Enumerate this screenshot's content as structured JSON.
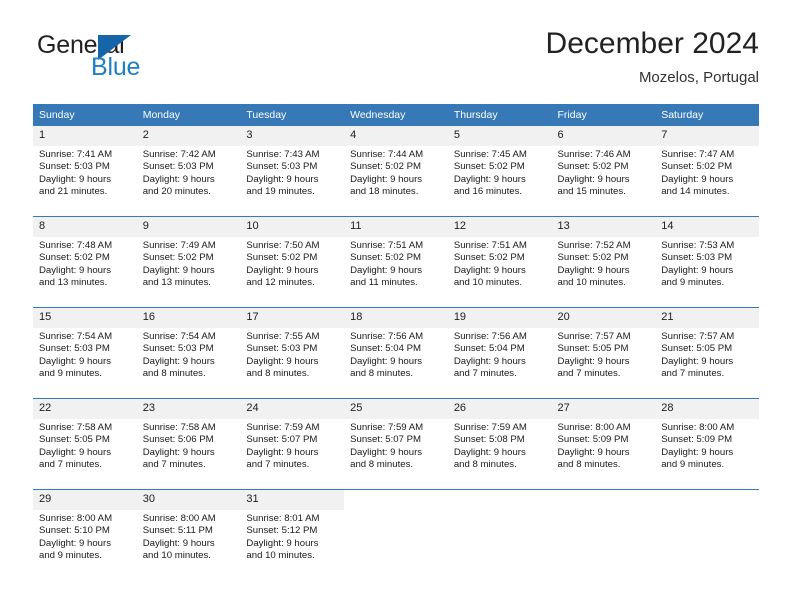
{
  "brand": {
    "name_top": "General",
    "name_bottom": "Blue",
    "triangle_icon": "triangle-logo-icon",
    "color_primary": "#1565a8",
    "color_secondary": "#1f7fc4"
  },
  "header": {
    "title": "December 2024",
    "location": "Mozelos, Portugal"
  },
  "theme": {
    "header_bg": "#3679b6",
    "daynum_bg": "#f1f1f1",
    "grid_line": "#3679b6"
  },
  "weekday_headers": [
    "Sunday",
    "Monday",
    "Tuesday",
    "Wednesday",
    "Thursday",
    "Friday",
    "Saturday"
  ],
  "weeks": [
    [
      {
        "day": "1",
        "sunrise": "Sunrise: 7:41 AM",
        "sunset": "Sunset: 5:03 PM",
        "daylight1": "Daylight: 9 hours",
        "daylight2": "and 21 minutes."
      },
      {
        "day": "2",
        "sunrise": "Sunrise: 7:42 AM",
        "sunset": "Sunset: 5:03 PM",
        "daylight1": "Daylight: 9 hours",
        "daylight2": "and 20 minutes."
      },
      {
        "day": "3",
        "sunrise": "Sunrise: 7:43 AM",
        "sunset": "Sunset: 5:03 PM",
        "daylight1": "Daylight: 9 hours",
        "daylight2": "and 19 minutes."
      },
      {
        "day": "4",
        "sunrise": "Sunrise: 7:44 AM",
        "sunset": "Sunset: 5:02 PM",
        "daylight1": "Daylight: 9 hours",
        "daylight2": "and 18 minutes."
      },
      {
        "day": "5",
        "sunrise": "Sunrise: 7:45 AM",
        "sunset": "Sunset: 5:02 PM",
        "daylight1": "Daylight: 9 hours",
        "daylight2": "and 16 minutes."
      },
      {
        "day": "6",
        "sunrise": "Sunrise: 7:46 AM",
        "sunset": "Sunset: 5:02 PM",
        "daylight1": "Daylight: 9 hours",
        "daylight2": "and 15 minutes."
      },
      {
        "day": "7",
        "sunrise": "Sunrise: 7:47 AM",
        "sunset": "Sunset: 5:02 PM",
        "daylight1": "Daylight: 9 hours",
        "daylight2": "and 14 minutes."
      }
    ],
    [
      {
        "day": "8",
        "sunrise": "Sunrise: 7:48 AM",
        "sunset": "Sunset: 5:02 PM",
        "daylight1": "Daylight: 9 hours",
        "daylight2": "and 13 minutes."
      },
      {
        "day": "9",
        "sunrise": "Sunrise: 7:49 AM",
        "sunset": "Sunset: 5:02 PM",
        "daylight1": "Daylight: 9 hours",
        "daylight2": "and 13 minutes."
      },
      {
        "day": "10",
        "sunrise": "Sunrise: 7:50 AM",
        "sunset": "Sunset: 5:02 PM",
        "daylight1": "Daylight: 9 hours",
        "daylight2": "and 12 minutes."
      },
      {
        "day": "11",
        "sunrise": "Sunrise: 7:51 AM",
        "sunset": "Sunset: 5:02 PM",
        "daylight1": "Daylight: 9 hours",
        "daylight2": "and 11 minutes."
      },
      {
        "day": "12",
        "sunrise": "Sunrise: 7:51 AM",
        "sunset": "Sunset: 5:02 PM",
        "daylight1": "Daylight: 9 hours",
        "daylight2": "and 10 minutes."
      },
      {
        "day": "13",
        "sunrise": "Sunrise: 7:52 AM",
        "sunset": "Sunset: 5:02 PM",
        "daylight1": "Daylight: 9 hours",
        "daylight2": "and 10 minutes."
      },
      {
        "day": "14",
        "sunrise": "Sunrise: 7:53 AM",
        "sunset": "Sunset: 5:03 PM",
        "daylight1": "Daylight: 9 hours",
        "daylight2": "and 9 minutes."
      }
    ],
    [
      {
        "day": "15",
        "sunrise": "Sunrise: 7:54 AM",
        "sunset": "Sunset: 5:03 PM",
        "daylight1": "Daylight: 9 hours",
        "daylight2": "and 9 minutes."
      },
      {
        "day": "16",
        "sunrise": "Sunrise: 7:54 AM",
        "sunset": "Sunset: 5:03 PM",
        "daylight1": "Daylight: 9 hours",
        "daylight2": "and 8 minutes."
      },
      {
        "day": "17",
        "sunrise": "Sunrise: 7:55 AM",
        "sunset": "Sunset: 5:03 PM",
        "daylight1": "Daylight: 9 hours",
        "daylight2": "and 8 minutes."
      },
      {
        "day": "18",
        "sunrise": "Sunrise: 7:56 AM",
        "sunset": "Sunset: 5:04 PM",
        "daylight1": "Daylight: 9 hours",
        "daylight2": "and 8 minutes."
      },
      {
        "day": "19",
        "sunrise": "Sunrise: 7:56 AM",
        "sunset": "Sunset: 5:04 PM",
        "daylight1": "Daylight: 9 hours",
        "daylight2": "and 7 minutes."
      },
      {
        "day": "20",
        "sunrise": "Sunrise: 7:57 AM",
        "sunset": "Sunset: 5:05 PM",
        "daylight1": "Daylight: 9 hours",
        "daylight2": "and 7 minutes."
      },
      {
        "day": "21",
        "sunrise": "Sunrise: 7:57 AM",
        "sunset": "Sunset: 5:05 PM",
        "daylight1": "Daylight: 9 hours",
        "daylight2": "and 7 minutes."
      }
    ],
    [
      {
        "day": "22",
        "sunrise": "Sunrise: 7:58 AM",
        "sunset": "Sunset: 5:05 PM",
        "daylight1": "Daylight: 9 hours",
        "daylight2": "and 7 minutes."
      },
      {
        "day": "23",
        "sunrise": "Sunrise: 7:58 AM",
        "sunset": "Sunset: 5:06 PM",
        "daylight1": "Daylight: 9 hours",
        "daylight2": "and 7 minutes."
      },
      {
        "day": "24",
        "sunrise": "Sunrise: 7:59 AM",
        "sunset": "Sunset: 5:07 PM",
        "daylight1": "Daylight: 9 hours",
        "daylight2": "and 7 minutes."
      },
      {
        "day": "25",
        "sunrise": "Sunrise: 7:59 AM",
        "sunset": "Sunset: 5:07 PM",
        "daylight1": "Daylight: 9 hours",
        "daylight2": "and 8 minutes."
      },
      {
        "day": "26",
        "sunrise": "Sunrise: 7:59 AM",
        "sunset": "Sunset: 5:08 PM",
        "daylight1": "Daylight: 9 hours",
        "daylight2": "and 8 minutes."
      },
      {
        "day": "27",
        "sunrise": "Sunrise: 8:00 AM",
        "sunset": "Sunset: 5:09 PM",
        "daylight1": "Daylight: 9 hours",
        "daylight2": "and 8 minutes."
      },
      {
        "day": "28",
        "sunrise": "Sunrise: 8:00 AM",
        "sunset": "Sunset: 5:09 PM",
        "daylight1": "Daylight: 9 hours",
        "daylight2": "and 9 minutes."
      }
    ],
    [
      {
        "day": "29",
        "sunrise": "Sunrise: 8:00 AM",
        "sunset": "Sunset: 5:10 PM",
        "daylight1": "Daylight: 9 hours",
        "daylight2": "and 9 minutes."
      },
      {
        "day": "30",
        "sunrise": "Sunrise: 8:00 AM",
        "sunset": "Sunset: 5:11 PM",
        "daylight1": "Daylight: 9 hours",
        "daylight2": "and 10 minutes."
      },
      {
        "day": "31",
        "sunrise": "Sunrise: 8:01 AM",
        "sunset": "Sunset: 5:12 PM",
        "daylight1": "Daylight: 9 hours",
        "daylight2": "and 10 minutes."
      },
      {
        "day": "",
        "sunrise": "",
        "sunset": "",
        "daylight1": "",
        "daylight2": ""
      },
      {
        "day": "",
        "sunrise": "",
        "sunset": "",
        "daylight1": "",
        "daylight2": ""
      },
      {
        "day": "",
        "sunrise": "",
        "sunset": "",
        "daylight1": "",
        "daylight2": ""
      },
      {
        "day": "",
        "sunrise": "",
        "sunset": "",
        "daylight1": "",
        "daylight2": ""
      }
    ]
  ]
}
